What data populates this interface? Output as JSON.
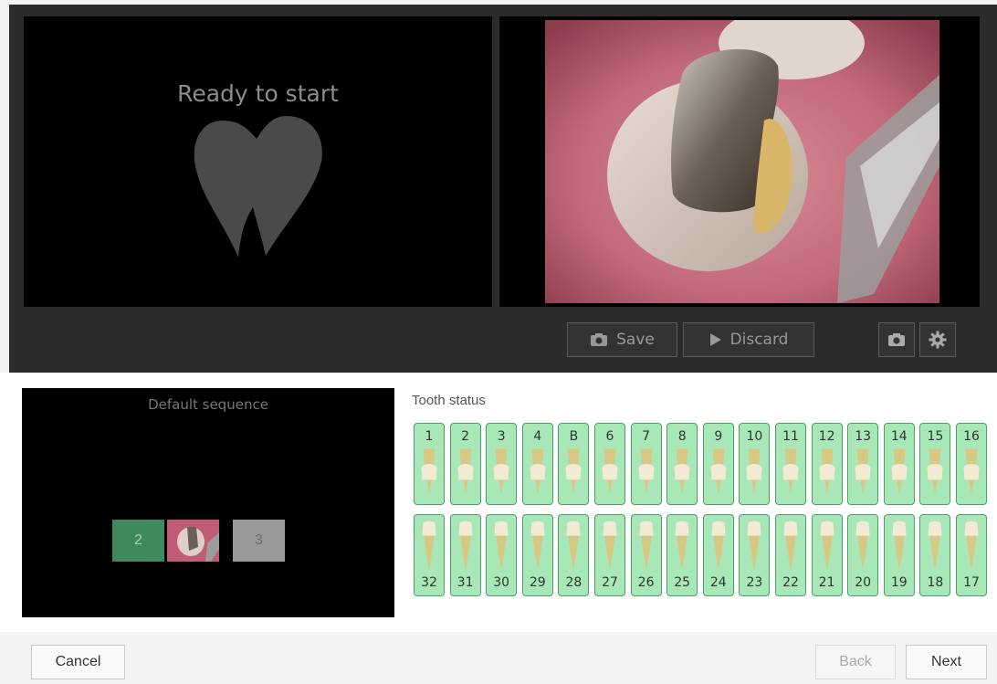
{
  "preview": {
    "status_text": "Ready to start"
  },
  "toolbar": {
    "save_label": "Save",
    "discard_label": "Discard"
  },
  "sequence": {
    "title": "Default sequence",
    "items": [
      "2",
      "3"
    ]
  },
  "tooth_status": {
    "label": "Tooth status",
    "upper": [
      "1",
      "2",
      "3",
      "4",
      "B",
      "6",
      "7",
      "8",
      "9",
      "10",
      "11",
      "12",
      "13",
      "14",
      "15",
      "16"
    ],
    "lower": [
      "32",
      "31",
      "30",
      "29",
      "28",
      "27",
      "26",
      "25",
      "24",
      "23",
      "22",
      "21",
      "20",
      "19",
      "18",
      "17"
    ]
  },
  "footer": {
    "cancel_label": "Cancel",
    "back_label": "Back",
    "next_label": "Next"
  },
  "colors": {
    "tooth_bg": "#a8e8b8",
    "seq_active": "#3e8a5c",
    "dark_bg": "#2b2b2b"
  }
}
